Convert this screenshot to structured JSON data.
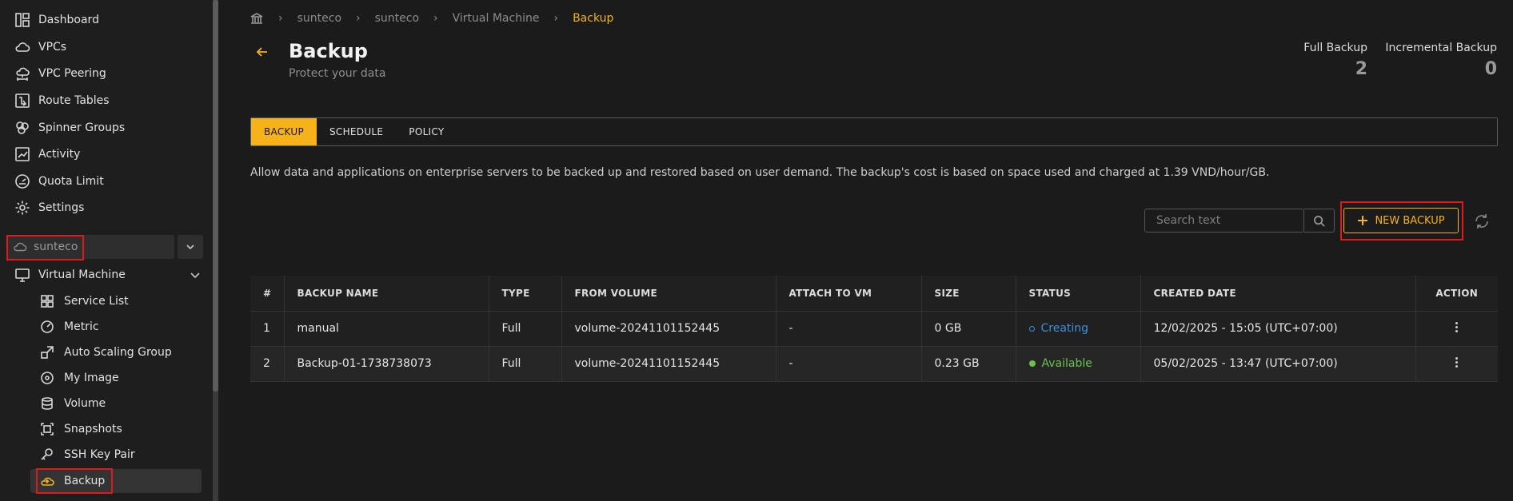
{
  "sidebar": {
    "items": [
      {
        "label": "Dashboard",
        "icon": "dashboard-icon"
      },
      {
        "label": "VPCs",
        "icon": "cloud-icon"
      },
      {
        "label": "VPC Peering",
        "icon": "cloud-network-icon"
      },
      {
        "label": "Route Tables",
        "icon": "route-icon"
      },
      {
        "label": "Spinner Groups",
        "icon": "groups-icon"
      },
      {
        "label": "Activity",
        "icon": "activity-icon"
      },
      {
        "label": "Quota Limit",
        "icon": "gauge-icon"
      },
      {
        "label": "Settings",
        "icon": "gear-icon"
      }
    ],
    "project": "sunteco",
    "group_label": "Virtual Machine",
    "sub_items": [
      {
        "label": "Service List",
        "icon": "grid-icon"
      },
      {
        "label": "Metric",
        "icon": "speedometer-icon"
      },
      {
        "label": "Auto Scaling Group",
        "icon": "scaling-icon"
      },
      {
        "label": "My Image",
        "icon": "disc-icon"
      },
      {
        "label": "Volume",
        "icon": "database-icon"
      },
      {
        "label": "Snapshots",
        "icon": "snapshot-icon"
      },
      {
        "label": "SSH Key Pair",
        "icon": "key-icon"
      },
      {
        "label": "Backup",
        "icon": "cloud-backup-icon"
      }
    ]
  },
  "breadcrumb": [
    "sunteco",
    "sunteco",
    "Virtual Machine",
    "Backup"
  ],
  "header": {
    "title": "Backup",
    "subtitle": "Protect your data"
  },
  "stats": {
    "full_label": "Full Backup",
    "full_value": "2",
    "incremental_label": "Incremental Backup",
    "incremental_value": "0"
  },
  "tabs": [
    "BACKUP",
    "SCHEDULE",
    "POLICY"
  ],
  "description": "Allow data and applications on enterprise servers to be backed up and restored based on user demand. The backup's cost is based on space used and charged at 1.39 VND/hour/GB.",
  "search": {
    "placeholder": "Search text"
  },
  "new_backup_label": "NEW BACKUP",
  "table": {
    "headers": [
      "#",
      "BACKUP NAME",
      "TYPE",
      "FROM VOLUME",
      "ATTACH TO VM",
      "SIZE",
      "STATUS",
      "CREATED DATE",
      "ACTION"
    ],
    "rows": [
      {
        "index": "1",
        "name": "manual",
        "type": "Full",
        "volume": "volume-20241101152445",
        "attach": "-",
        "size": "0 GB",
        "status": "Creating",
        "created": "12/02/2025 - 15:05 (UTC+07:00)"
      },
      {
        "index": "2",
        "name": "Backup-01-1738738073",
        "type": "Full",
        "volume": "volume-20241101152445",
        "attach": "-",
        "size": "0.23 GB",
        "status": "Available",
        "created": "05/02/2025 - 13:47 (UTC+07:00)"
      }
    ]
  },
  "colors": {
    "accent": "#f5b21a",
    "creating": "#3d8fe0",
    "available": "#6cc24a",
    "highlight": "#e0191b"
  }
}
